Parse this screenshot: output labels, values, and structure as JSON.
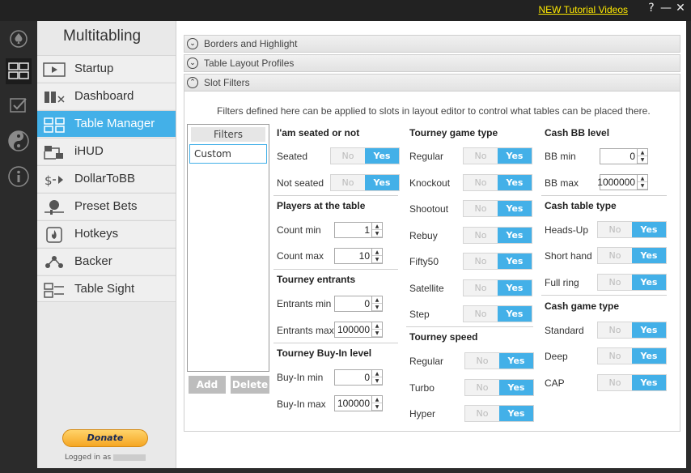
{
  "titlebar": {
    "tutorial_link": "NEW Tutorial Videos",
    "help": "?",
    "minimize": "—",
    "close": "✕"
  },
  "nav": {
    "title": "Multitabling",
    "items": [
      {
        "label": "Startup"
      },
      {
        "label": "Dashboard"
      },
      {
        "label": "Table Manager"
      },
      {
        "label": "iHUD"
      },
      {
        "label": "DollarToBB"
      },
      {
        "label": "Preset Bets"
      },
      {
        "label": "Hotkeys"
      },
      {
        "label": "Backer"
      },
      {
        "label": "Table Sight"
      }
    ],
    "donate": "Donate",
    "logged_in": "Logged in as"
  },
  "accordion": {
    "borders": "Borders and Highlight",
    "layouts": "Table Layout Profiles",
    "slot": "Slot Filters"
  },
  "slot": {
    "description": "Filters defined here can be applied to slots in layout editor to control what tables can be placed there.",
    "list_header": "Filters",
    "list_item": "Custom",
    "add": "Add",
    "delete": "Delete"
  },
  "toggle": {
    "no": "No",
    "yes": "Yes"
  },
  "col1": {
    "seated_title": "I'am seated or not",
    "seated": "Seated",
    "not_seated": "Not seated",
    "players_title": "Players at the table",
    "count_min": "Count min",
    "count_min_v": "1",
    "count_max": "Count max",
    "count_max_v": "10",
    "entrants_title": "Tourney entrants",
    "entrants_min": "Entrants min",
    "entrants_min_v": "0",
    "entrants_max": "Entrants max",
    "entrants_max_v": "100000",
    "buyin_title": "Tourney Buy-In level",
    "buyin_min": "Buy-In min",
    "buyin_min_v": "0",
    "buyin_max": "Buy-In max",
    "buyin_max_v": "100000"
  },
  "col2": {
    "gametype_title": "Tourney game type",
    "regular": "Regular",
    "knockout": "Knockout",
    "shootout": "Shootout",
    "rebuy": "Rebuy",
    "fifty50": "Fifty50",
    "satellite": "Satellite",
    "step": "Step",
    "speed_title": "Tourney speed",
    "sp_regular": "Regular",
    "turbo": "Turbo",
    "hyper": "Hyper"
  },
  "col3": {
    "bb_title": "Cash BB level",
    "bb_min": "BB min",
    "bb_min_v": "0",
    "bb_max": "BB max",
    "bb_max_v": "1000000",
    "tabletype_title": "Cash table type",
    "headsup": "Heads-Up",
    "short": "Short hand",
    "full": "Full ring",
    "gametype_title": "Cash game type",
    "standard": "Standard",
    "deep": "Deep",
    "cap": "CAP"
  }
}
